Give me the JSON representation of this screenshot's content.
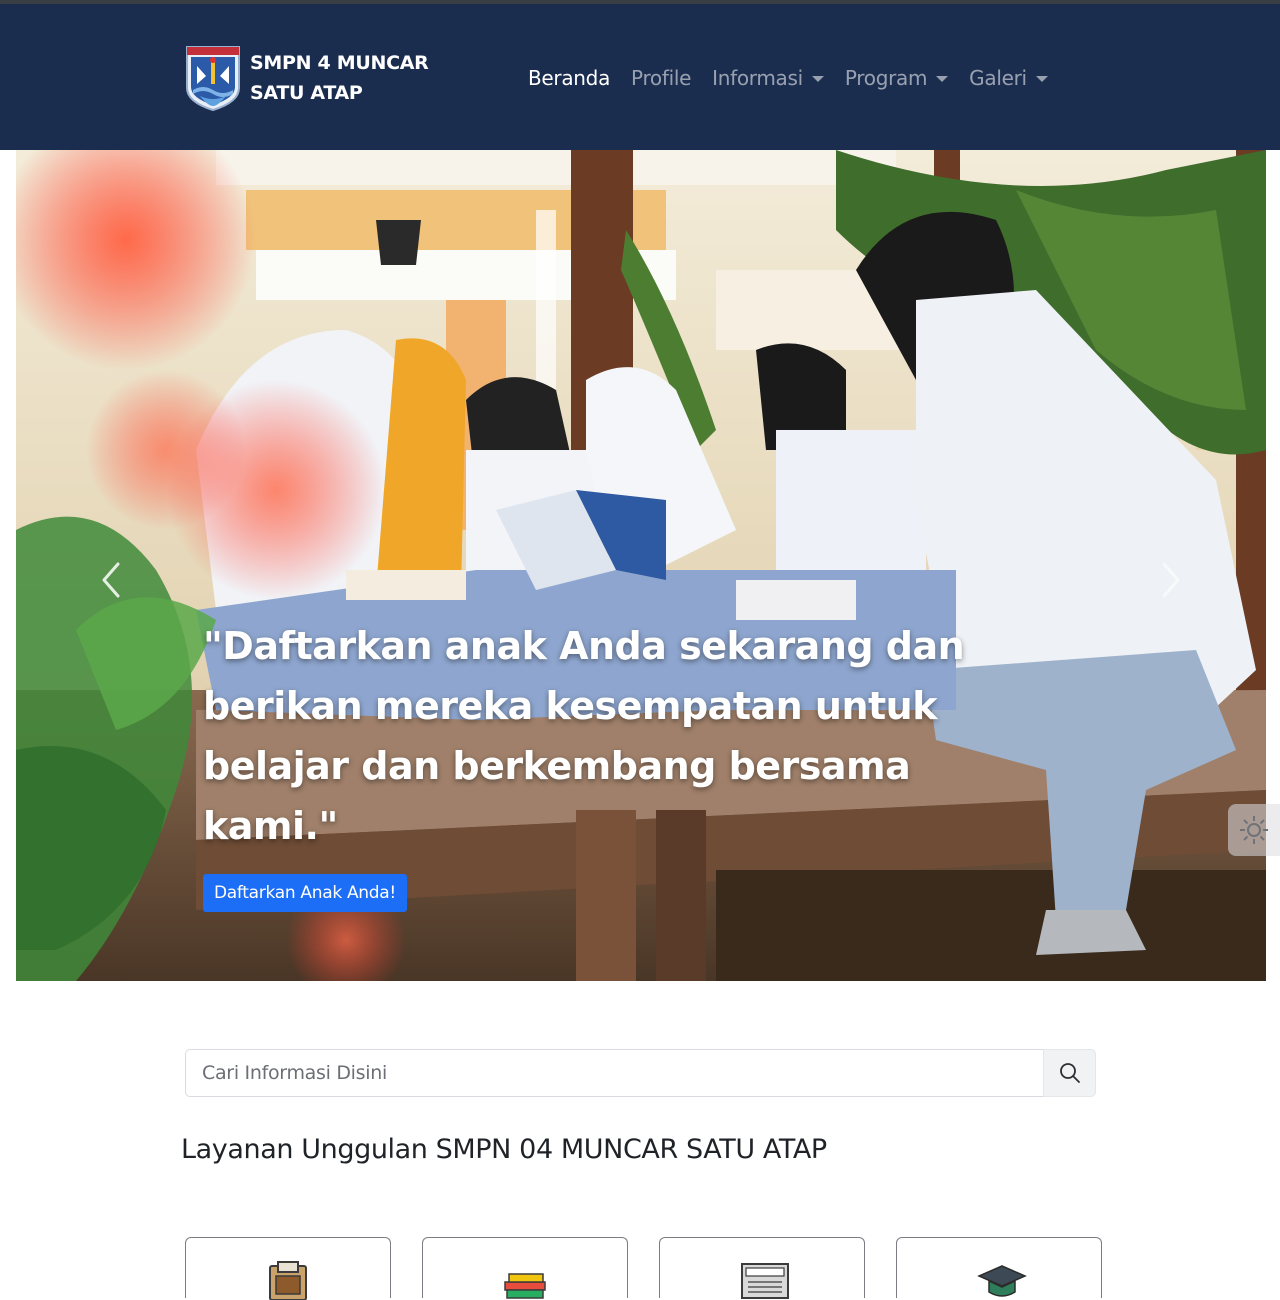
{
  "navbar": {
    "brand_line1": "SMPN 4 MUNCAR",
    "brand_line2": "SATU ATAP",
    "logo_icon": "school-crest-icon",
    "items": [
      {
        "label": "Beranda",
        "active": true,
        "dropdown": false
      },
      {
        "label": "Profile",
        "active": false,
        "dropdown": false
      },
      {
        "label": "Informasi",
        "active": false,
        "dropdown": true
      },
      {
        "label": "Program",
        "active": false,
        "dropdown": true
      },
      {
        "label": "Galeri",
        "active": false,
        "dropdown": true
      }
    ]
  },
  "hero": {
    "caption": "\"Daftarkan anak Anda sekarang dan berikan mereka kesempatan untuk belajar dan berkembang bersama kami.\"",
    "cta_label": "Daftarkan Anak Anda!",
    "prev_icon": "chevron-left-icon",
    "next_icon": "chevron-right-icon"
  },
  "search": {
    "placeholder": "Cari Informasi Disini",
    "value": "",
    "button_icon": "search-icon"
  },
  "services": {
    "title": "Layanan Unggulan SMPN 04 MUNCAR SATU ATAP",
    "cards": [
      {
        "icon": "document-folder-icon"
      },
      {
        "icon": "books-icon"
      },
      {
        "icon": "newspaper-icon"
      },
      {
        "icon": "graduation-cap-icon"
      }
    ]
  },
  "colors": {
    "navbar_bg": "#1b2d4f",
    "cta_bg": "#1b6ef5",
    "nav_active": "#ffffff",
    "nav_inactive": "#9aa3b3"
  }
}
